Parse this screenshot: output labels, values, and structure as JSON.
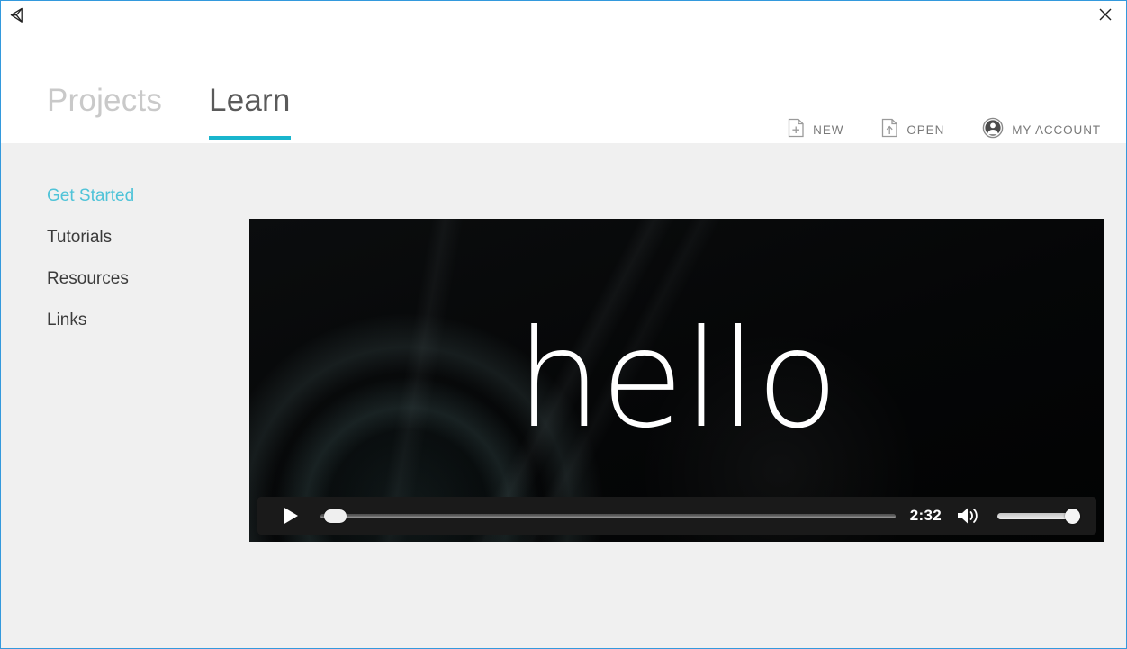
{
  "window": {
    "app_logo_name": "unity-logo-icon",
    "close_label": "×",
    "border_color": "#3399dd",
    "background_color": "#f0f0f0"
  },
  "header": {
    "accent_color": "#19b5cd",
    "tabs": [
      {
        "label": "Projects",
        "active": false
      },
      {
        "label": "Learn",
        "active": true
      }
    ],
    "actions": [
      {
        "label": "NEW",
        "icon": "new-document-icon"
      },
      {
        "label": "OPEN",
        "icon": "open-document-icon"
      },
      {
        "label": "MY ACCOUNT",
        "icon": "account-avatar-icon"
      }
    ]
  },
  "sidebar": {
    "items": [
      {
        "label": "Get Started",
        "active": true
      },
      {
        "label": "Tutorials",
        "active": false
      },
      {
        "label": "Resources",
        "active": false
      },
      {
        "label": "Links",
        "active": false
      }
    ],
    "active_color": "#4fc3d8"
  },
  "video": {
    "overlay_text": "hello",
    "controls": {
      "play_icon": "play-triangle-icon",
      "time": "2:32",
      "volume_icon": "speaker-volume-icon",
      "seek_position_percent": 0,
      "volume_level_percent": 100
    }
  }
}
